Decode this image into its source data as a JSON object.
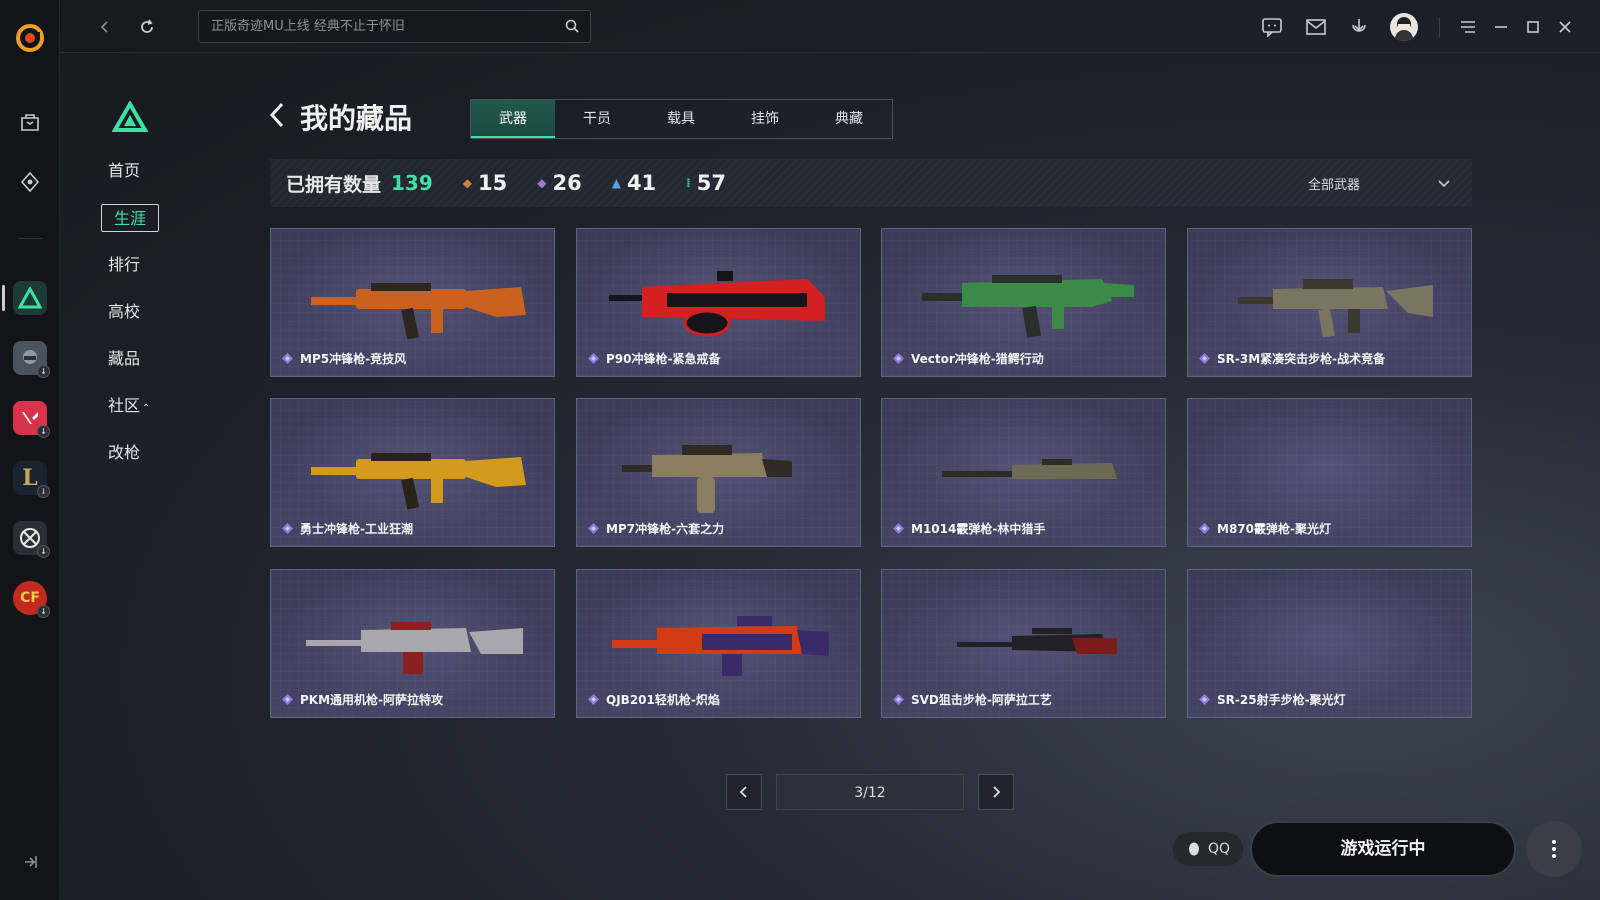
{
  "app": {
    "accent": "#3ee0a6"
  },
  "topbar": {
    "search_placeholder": "正版奇迹MU上线 经典不止于怀旧",
    "icons": [
      "chat-icon",
      "mail-icon",
      "download-icon",
      "avatar",
      "menu-icon",
      "minimize-icon",
      "maximize-icon",
      "close-icon"
    ]
  },
  "rail": {
    "games": [
      "store",
      "discover",
      "delta-force",
      "pubg",
      "valorant",
      "league-of-legends",
      "apex",
      "crossfire"
    ]
  },
  "nav": {
    "items": [
      "首页",
      "生涯",
      "排行",
      "高校",
      "藏品",
      "社区",
      "改枪"
    ],
    "active": "生涯"
  },
  "page": {
    "title": "我的藏品"
  },
  "tabs": [
    "武器",
    "干员",
    "载具",
    "挂饰",
    "典藏"
  ],
  "stats": {
    "owned_label": "已拥有数量",
    "owned_total": "139",
    "tiers": [
      {
        "value": "15",
        "color": "#c5853a"
      },
      {
        "value": "26",
        "color": "#9b7bd8"
      },
      {
        "value": "41",
        "color": "#5a9ee0"
      },
      {
        "value": "57",
        "color": "#3ec79a"
      }
    ],
    "filter": "全部武器"
  },
  "items": [
    {
      "name": "MP5冲锋枪-竞技风",
      "c1": "#c8621e",
      "c2": "#2d2520",
      "kind": "smg"
    },
    {
      "name": "P90冲锋枪-紧急戒备",
      "c1": "#d42020",
      "c2": "#151418",
      "kind": "p90"
    },
    {
      "name": "Vector冲锋枪-猎鳄行动",
      "c1": "#3c8a48",
      "c2": "#2a2f2b",
      "kind": "vector"
    },
    {
      "name": "SR-3M紧凑突击步枪-战术竞备",
      "c1": "#7a7560",
      "c2": "#3a382f",
      "kind": "rifle"
    },
    {
      "name": "勇士冲锋枪-工业狂潮",
      "c1": "#d49a1e",
      "c2": "#2a2218",
      "kind": "smg"
    },
    {
      "name": "MP7冲锋枪-六套之力",
      "c1": "#8a7e5e",
      "c2": "#2e2b24",
      "kind": "mp7"
    },
    {
      "name": "M1014霰弹枪-林中猎手",
      "c1": "#6e6a52",
      "c2": "#2c2b24",
      "kind": "long"
    },
    {
      "name": "M870霰弹枪-聚光灯",
      "c1": "",
      "c2": "",
      "kind": "empty"
    },
    {
      "name": "PKM通用机枪-阿萨拉特攻",
      "c1": "#a8a8ac",
      "c2": "#8a2020",
      "kind": "lmg"
    },
    {
      "name": "QJB201轻机枪-炽焰",
      "c1": "#d43a14",
      "c2": "#3a2a6a",
      "kind": "lmg2"
    },
    {
      "name": "SVD狙击步枪-阿萨拉工艺",
      "c1": "#7a1c1c",
      "c2": "#222226",
      "kind": "sniper"
    },
    {
      "name": "SR-25射手步枪-聚光灯",
      "c1": "",
      "c2": "",
      "kind": "empty"
    }
  ],
  "pager": {
    "label": "3/12"
  },
  "footer": {
    "qq": "QQ",
    "run_button": "游戏运行中"
  }
}
